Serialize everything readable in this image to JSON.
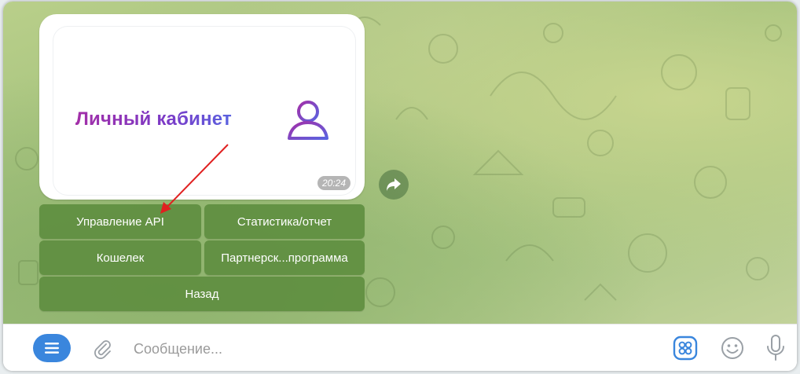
{
  "message": {
    "card_title": "Личный кабинет",
    "time": "20:24",
    "icon": "user-outline-icon"
  },
  "keyboard": {
    "buttons": [
      {
        "label": "Управление API"
      },
      {
        "label": "Статистика/отчет"
      },
      {
        "label": "Кошелек"
      },
      {
        "label": "Партнерск...программа"
      },
      {
        "label": "Назад"
      }
    ]
  },
  "composer": {
    "placeholder": "Сообщение...",
    "icons": [
      "menu-icon",
      "paperclip-icon",
      "bot-keyboard-icon",
      "emoji-icon",
      "microphone-icon"
    ]
  },
  "colors": {
    "accent": "#3a86dd",
    "keyboard_button": "#5c8c3e",
    "annotation_arrow": "#e02020",
    "title_gradient_start": "#a32fa8",
    "title_gradient_end": "#5a63e0"
  }
}
